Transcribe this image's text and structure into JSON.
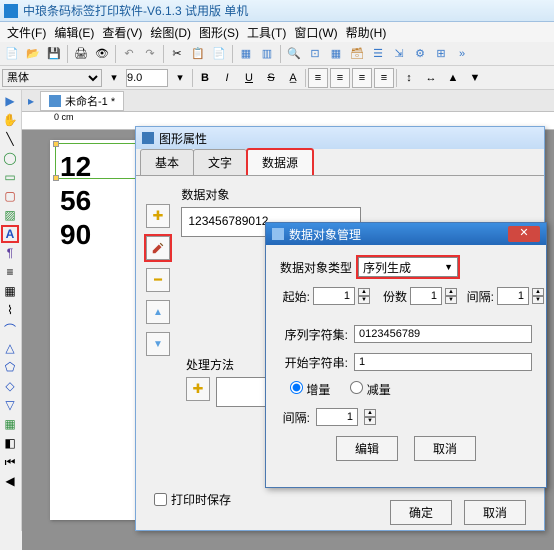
{
  "app": {
    "title": "中琅条码标签打印软件-V6.1.3 试用版 单机"
  },
  "menu": [
    "文件(F)",
    "编辑(E)",
    "查看(V)",
    "绘图(D)",
    "图形(S)",
    "工具(T)",
    "窗口(W)",
    "帮助(H)"
  ],
  "formatbar": {
    "fontname": "黑体",
    "fontsize": "9.0"
  },
  "document": {
    "tab": "未命名-1 *",
    "ruler0": "0 cm"
  },
  "canvas": {
    "line1": "12",
    "line2": "56",
    "line3": "90"
  },
  "propwin": {
    "title": "图形属性",
    "tabs": [
      "基本",
      "文字",
      "数据源"
    ],
    "data_objects_label": "数据对象",
    "process_label": "处理方法",
    "item1": "123456789012",
    "save_on_print_label": "打印时保存",
    "ok": "确定",
    "cancel": "取消"
  },
  "dlog": {
    "title": "数据对象管理",
    "type_label": "数据对象类型",
    "type_value": "序列生成",
    "start_label": "起始:",
    "start_value": "1",
    "copies_label": "份数",
    "copies_value": "1",
    "gap_label": "间隔:",
    "gap_value": "1",
    "charset_label": "序列字符集:",
    "charset_value": "0123456789",
    "startstr_label": "开始字符串:",
    "startstr_value": "1",
    "radio_inc": "增量",
    "radio_dec": "减量",
    "gap2_label": "间隔:",
    "gap2_value": "1",
    "edit_btn": "编辑",
    "cancel_btn": "取消"
  }
}
